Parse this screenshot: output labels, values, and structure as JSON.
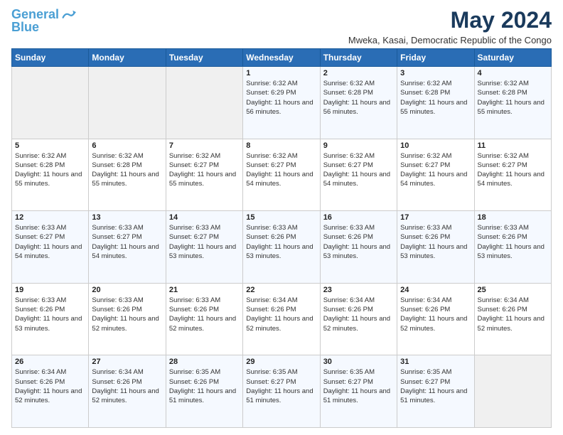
{
  "logo": {
    "line1": "General",
    "line2": "Blue"
  },
  "title": "May 2024",
  "subtitle": "Mweka, Kasai, Democratic Republic of the Congo",
  "days_of_week": [
    "Sunday",
    "Monday",
    "Tuesday",
    "Wednesday",
    "Thursday",
    "Friday",
    "Saturday"
  ],
  "weeks": [
    [
      {
        "day": "",
        "info": ""
      },
      {
        "day": "",
        "info": ""
      },
      {
        "day": "",
        "info": ""
      },
      {
        "day": "1",
        "info": "Sunrise: 6:32 AM\nSunset: 6:29 PM\nDaylight: 11 hours and 56 minutes."
      },
      {
        "day": "2",
        "info": "Sunrise: 6:32 AM\nSunset: 6:28 PM\nDaylight: 11 hours and 56 minutes."
      },
      {
        "day": "3",
        "info": "Sunrise: 6:32 AM\nSunset: 6:28 PM\nDaylight: 11 hours and 55 minutes."
      },
      {
        "day": "4",
        "info": "Sunrise: 6:32 AM\nSunset: 6:28 PM\nDaylight: 11 hours and 55 minutes."
      }
    ],
    [
      {
        "day": "5",
        "info": "Sunrise: 6:32 AM\nSunset: 6:28 PM\nDaylight: 11 hours and 55 minutes."
      },
      {
        "day": "6",
        "info": "Sunrise: 6:32 AM\nSunset: 6:28 PM\nDaylight: 11 hours and 55 minutes."
      },
      {
        "day": "7",
        "info": "Sunrise: 6:32 AM\nSunset: 6:27 PM\nDaylight: 11 hours and 55 minutes."
      },
      {
        "day": "8",
        "info": "Sunrise: 6:32 AM\nSunset: 6:27 PM\nDaylight: 11 hours and 54 minutes."
      },
      {
        "day": "9",
        "info": "Sunrise: 6:32 AM\nSunset: 6:27 PM\nDaylight: 11 hours and 54 minutes."
      },
      {
        "day": "10",
        "info": "Sunrise: 6:32 AM\nSunset: 6:27 PM\nDaylight: 11 hours and 54 minutes."
      },
      {
        "day": "11",
        "info": "Sunrise: 6:32 AM\nSunset: 6:27 PM\nDaylight: 11 hours and 54 minutes."
      }
    ],
    [
      {
        "day": "12",
        "info": "Sunrise: 6:33 AM\nSunset: 6:27 PM\nDaylight: 11 hours and 54 minutes."
      },
      {
        "day": "13",
        "info": "Sunrise: 6:33 AM\nSunset: 6:27 PM\nDaylight: 11 hours and 54 minutes."
      },
      {
        "day": "14",
        "info": "Sunrise: 6:33 AM\nSunset: 6:27 PM\nDaylight: 11 hours and 53 minutes."
      },
      {
        "day": "15",
        "info": "Sunrise: 6:33 AM\nSunset: 6:26 PM\nDaylight: 11 hours and 53 minutes."
      },
      {
        "day": "16",
        "info": "Sunrise: 6:33 AM\nSunset: 6:26 PM\nDaylight: 11 hours and 53 minutes."
      },
      {
        "day": "17",
        "info": "Sunrise: 6:33 AM\nSunset: 6:26 PM\nDaylight: 11 hours and 53 minutes."
      },
      {
        "day": "18",
        "info": "Sunrise: 6:33 AM\nSunset: 6:26 PM\nDaylight: 11 hours and 53 minutes."
      }
    ],
    [
      {
        "day": "19",
        "info": "Sunrise: 6:33 AM\nSunset: 6:26 PM\nDaylight: 11 hours and 53 minutes."
      },
      {
        "day": "20",
        "info": "Sunrise: 6:33 AM\nSunset: 6:26 PM\nDaylight: 11 hours and 52 minutes."
      },
      {
        "day": "21",
        "info": "Sunrise: 6:33 AM\nSunset: 6:26 PM\nDaylight: 11 hours and 52 minutes."
      },
      {
        "day": "22",
        "info": "Sunrise: 6:34 AM\nSunset: 6:26 PM\nDaylight: 11 hours and 52 minutes."
      },
      {
        "day": "23",
        "info": "Sunrise: 6:34 AM\nSunset: 6:26 PM\nDaylight: 11 hours and 52 minutes."
      },
      {
        "day": "24",
        "info": "Sunrise: 6:34 AM\nSunset: 6:26 PM\nDaylight: 11 hours and 52 minutes."
      },
      {
        "day": "25",
        "info": "Sunrise: 6:34 AM\nSunset: 6:26 PM\nDaylight: 11 hours and 52 minutes."
      }
    ],
    [
      {
        "day": "26",
        "info": "Sunrise: 6:34 AM\nSunset: 6:26 PM\nDaylight: 11 hours and 52 minutes."
      },
      {
        "day": "27",
        "info": "Sunrise: 6:34 AM\nSunset: 6:26 PM\nDaylight: 11 hours and 52 minutes."
      },
      {
        "day": "28",
        "info": "Sunrise: 6:35 AM\nSunset: 6:26 PM\nDaylight: 11 hours and 51 minutes."
      },
      {
        "day": "29",
        "info": "Sunrise: 6:35 AM\nSunset: 6:27 PM\nDaylight: 11 hours and 51 minutes."
      },
      {
        "day": "30",
        "info": "Sunrise: 6:35 AM\nSunset: 6:27 PM\nDaylight: 11 hours and 51 minutes."
      },
      {
        "day": "31",
        "info": "Sunrise: 6:35 AM\nSunset: 6:27 PM\nDaylight: 11 hours and 51 minutes."
      },
      {
        "day": "",
        "info": ""
      }
    ]
  ]
}
